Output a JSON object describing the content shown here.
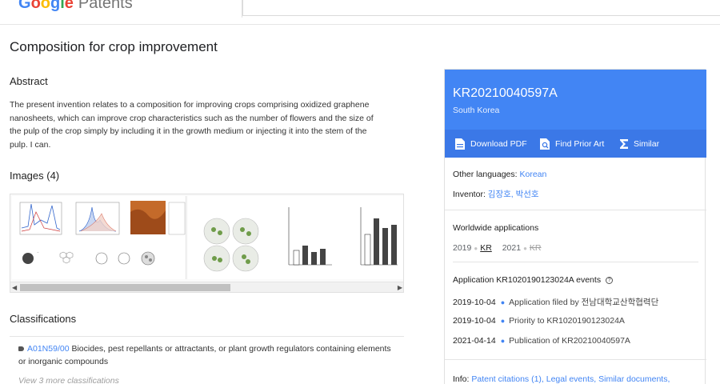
{
  "header": {
    "logo_google": [
      "G",
      "o",
      "o",
      "g",
      "l",
      "e"
    ],
    "logo_product": "Patents"
  },
  "patent": {
    "title": "Composition for crop improvement",
    "abstract_heading": "Abstract",
    "abstract": "The present invention relates to a composition for improving crops comprising oxidized graphene nanosheets, which can improve crop characteristics such as the number of flowers and the size of the pulp of the crop simply by including it in the growth medium or injecting it into the stem of the pulp. I can.",
    "images_heading": "Images (4)",
    "classifications_heading": "Classifications",
    "classification": {
      "code": "A01N59/00",
      "description": "Biocides, pest repellants or attractants, or plant growth regulators containing elements or inorganic compounds"
    },
    "more_classifications": "View 3 more classifications"
  },
  "card": {
    "publication_number": "KR20210040597A",
    "country": "South Korea",
    "actions": {
      "download_pdf": "Download PDF",
      "find_prior_art": "Find Prior Art",
      "similar": "Similar"
    },
    "other_languages_label": "Other languages:",
    "other_languages_value": "Korean",
    "inventor_label": "Inventor:",
    "inventor_value": "김장호, 박선호",
    "worldwide_heading": "Worldwide applications",
    "worldwide": [
      {
        "year": "2019",
        "country": "KR",
        "active": true
      },
      {
        "year": "2021",
        "country": "KR",
        "active": false
      }
    ],
    "events_heading": "Application KR1020190123024A events",
    "events": [
      {
        "date": "2019-10-04",
        "desc": "Application filed by 전남대학교산학협력단"
      },
      {
        "date": "2019-10-04",
        "desc": "Priority to KR1020190123024A"
      },
      {
        "date": "2021-04-14",
        "desc": "Publication of KR20210040597A"
      }
    ],
    "info_label": "Info:",
    "info_links": "Patent citations (1), Legal events, Similar documents,"
  },
  "colors": {
    "brand_blue": "#4285f4",
    "action_bar": "#3b78e7"
  }
}
